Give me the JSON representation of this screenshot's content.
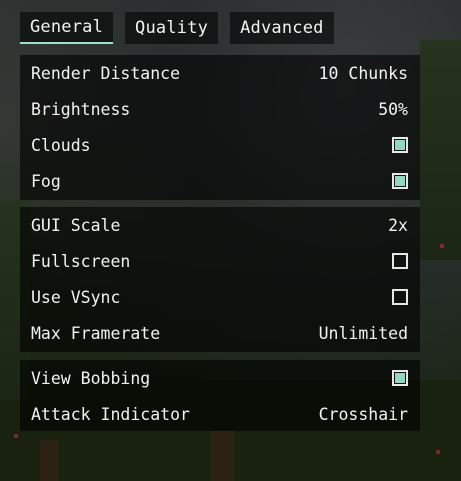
{
  "tabs": [
    {
      "label": "General",
      "active": true
    },
    {
      "label": "Quality",
      "active": false
    },
    {
      "label": "Advanced",
      "active": false
    }
  ],
  "groups": [
    [
      {
        "label": "Render Distance",
        "type": "value",
        "value": "10 Chunks"
      },
      {
        "label": "Brightness",
        "type": "value",
        "value": "50%"
      },
      {
        "label": "Clouds",
        "type": "checkbox",
        "checked": true
      },
      {
        "label": "Fog",
        "type": "checkbox",
        "checked": true
      }
    ],
    [
      {
        "label": "GUI Scale",
        "type": "value",
        "value": "2x"
      },
      {
        "label": "Fullscreen",
        "type": "checkbox",
        "checked": false
      },
      {
        "label": "Use VSync",
        "type": "checkbox",
        "checked": false
      },
      {
        "label": "Max Framerate",
        "type": "value",
        "value": "Unlimited"
      }
    ],
    [
      {
        "label": "View Bobbing",
        "type": "checkbox",
        "checked": true
      },
      {
        "label": "Attack Indicator",
        "type": "value",
        "value": "Crosshair"
      }
    ]
  ],
  "colors": {
    "accent": "#9fe0cf",
    "checkbox_fill": "#8fd8c4",
    "panel_bg": "rgba(0,0,0,0.6)",
    "text": "#f2f2f2"
  }
}
